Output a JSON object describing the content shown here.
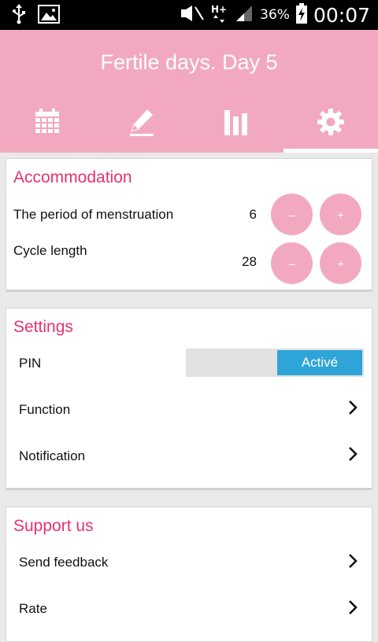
{
  "status_bar": {
    "battery_percent": "36%",
    "time": "00:07",
    "icons": [
      "usb-icon",
      "image-icon",
      "mute-icon",
      "hplus-signal-icon",
      "signal-bars-icon",
      "battery-charging-icon"
    ]
  },
  "header": {
    "title": "Fertile days. Day 5",
    "tabs": [
      {
        "icon": "calendar-icon",
        "active": false
      },
      {
        "icon": "pencil-icon",
        "active": false
      },
      {
        "icon": "bar-chart-icon",
        "active": false
      },
      {
        "icon": "gear-icon",
        "active": true
      }
    ]
  },
  "accommodation": {
    "title": "Accommodation",
    "rows": [
      {
        "label": "The period of menstruation",
        "value": "6",
        "minus": "–",
        "plus": "+"
      },
      {
        "label": "Cycle length",
        "value": "28",
        "minus": "–",
        "plus": "+"
      }
    ]
  },
  "settings": {
    "title": "Settings",
    "pin_label": "PIN",
    "pin_toggle": "Activé",
    "function_label": "Function",
    "notification_label": "Notification"
  },
  "support": {
    "title": "Support us",
    "feedback_label": "Send feedback",
    "rate_label": "Rate"
  },
  "colors": {
    "header_pink": "#f2a9c0",
    "accent_magenta": "#e8326e",
    "toggle_blue": "#2ea4d8"
  }
}
